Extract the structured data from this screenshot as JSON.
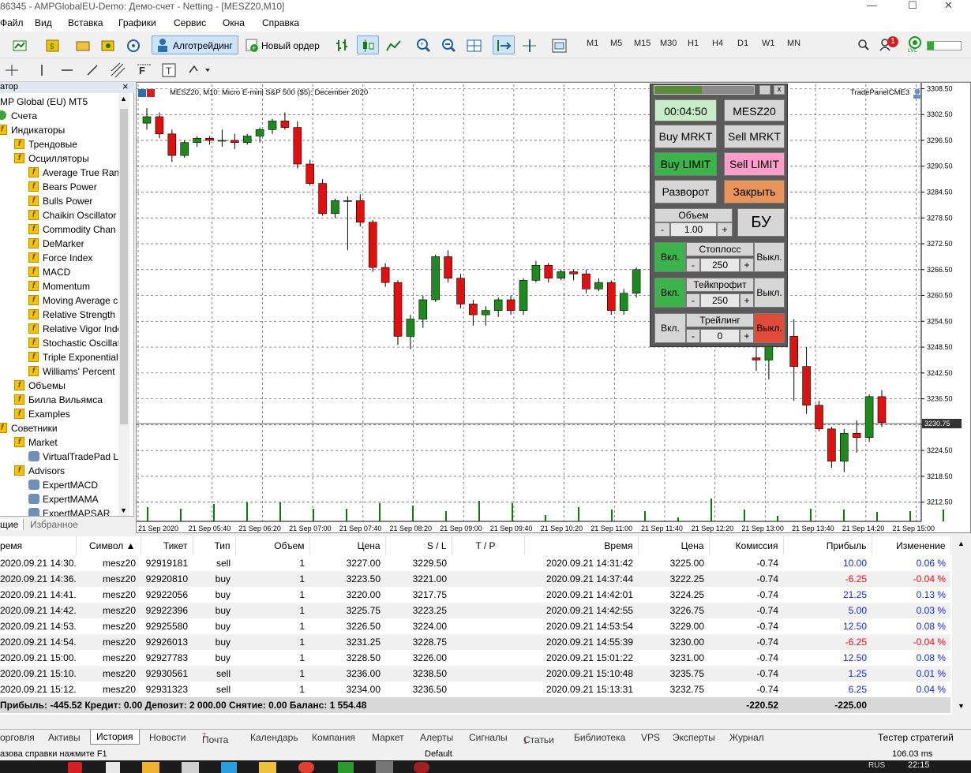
{
  "window": {
    "title": "86345 - AMPGlobalEU-Demo: Демо-счет - Netting - [MESZ20,M10]",
    "min_icon": "minimize-icon",
    "max_icon": "maximize-icon",
    "close_icon": "close-icon"
  },
  "menu": [
    "Файл",
    "Вид",
    "Вставка",
    "Графики",
    "Сервис",
    "Окна",
    "Справка"
  ],
  "toolbar": {
    "algo_label": "Алготрейдинг",
    "new_order_label": "Новый ордер",
    "timeframes": [
      "M1",
      "M5",
      "M15",
      "M30",
      "H1",
      "H4",
      "D1",
      "W1",
      "MN"
    ],
    "notification_count": "1",
    "signal_label": "LVL"
  },
  "navigator": {
    "header": "атор",
    "items": [
      {
        "label": "MP Global (EU) MT5",
        "type": "root"
      },
      {
        "label": "Счета",
        "type": "accounts"
      },
      {
        "label": "Индикаторы",
        "type": "folder"
      },
      {
        "label": "Трендовые",
        "type": "folder"
      },
      {
        "label": "Осцилляторы",
        "type": "folder"
      },
      {
        "label": "Average True Rang",
        "type": "ind"
      },
      {
        "label": "Bears Power",
        "type": "ind"
      },
      {
        "label": "Bulls Power",
        "type": "ind"
      },
      {
        "label": "Chaikin Oscillator",
        "type": "ind"
      },
      {
        "label": "Commodity Chan",
        "type": "ind"
      },
      {
        "label": "DeMarker",
        "type": "ind"
      },
      {
        "label": "Force Index",
        "type": "ind"
      },
      {
        "label": "MACD",
        "type": "ind"
      },
      {
        "label": "Momentum",
        "type": "ind"
      },
      {
        "label": "Moving Average c",
        "type": "ind"
      },
      {
        "label": "Relative Strength I",
        "type": "ind"
      },
      {
        "label": "Relative Vigor Inde",
        "type": "ind"
      },
      {
        "label": "Stochastic Oscillat",
        "type": "ind"
      },
      {
        "label": "Triple Exponential",
        "type": "ind"
      },
      {
        "label": "Williams' Percent",
        "type": "ind"
      },
      {
        "label": "Объемы",
        "type": "folder"
      },
      {
        "label": "Билла Вильямса",
        "type": "folder"
      },
      {
        "label": "Examples",
        "type": "folder"
      },
      {
        "label": "Советники",
        "type": "folder"
      },
      {
        "label": "Market",
        "type": "folder"
      },
      {
        "label": "VirtualTradePad  L",
        "type": "ea"
      },
      {
        "label": "Advisors",
        "type": "folder"
      },
      {
        "label": "ExpertMACD",
        "type": "ea"
      },
      {
        "label": "ExpertMAMA",
        "type": "ea"
      },
      {
        "label": "ExpertMAPSAR",
        "type": "ea"
      }
    ],
    "tab_common": "щие",
    "tab_favorites": "Избранное"
  },
  "chart": {
    "header": "MESZ20, M10:  Micro E-mini S&P 500 ($5): December 2020",
    "panel_name": "TradePanelCME3",
    "current_price": "3230.75"
  },
  "chart_data": {
    "type": "candlestick",
    "y_ticks": [
      "3308.50",
      "3302.50",
      "3296.50",
      "3290.50",
      "3284.50",
      "3278.50",
      "3272.50",
      "3266.50",
      "3260.50",
      "3254.50",
      "3248.50",
      "3242.50",
      "3236.50",
      "3230.50",
      "3224.50",
      "3218.50",
      "3212.50"
    ],
    "ylim": [
      3209.5,
      3309.5
    ],
    "x_ticks": [
      "21 Sep 2020",
      "21 Sep 05:40",
      "21 Sep 06:20",
      "21 Sep 07:00",
      "21 Sep 07:40",
      "21 Sep 08:20",
      "21 Sep 09:00",
      "21 Sep 09:40",
      "21 Sep 10:20",
      "21 Sep 11:00",
      "21 Sep 11:40",
      "21 Sep 12:20",
      "21 Sep 13:00",
      "21 Sep 13:40",
      "21 Sep 14:20",
      "21 Sep 15:00"
    ],
    "candles": [
      [
        3300.5,
        3304.0,
        3299.0,
        3302.0
      ],
      [
        3302.0,
        3303.0,
        3297.0,
        3298.0
      ],
      [
        3298.0,
        3299.0,
        3291.5,
        3293.0
      ],
      [
        3293.0,
        3296.5,
        3292.5,
        3296.0
      ],
      [
        3296.0,
        3297.5,
        3295.0,
        3297.0
      ],
      [
        3297.0,
        3297.5,
        3295.5,
        3296.5
      ],
      [
        3296.5,
        3299.0,
        3295.0,
        3296.5
      ],
      [
        3296.5,
        3298.0,
        3294.5,
        3296.0
      ],
      [
        3296.0,
        3298.0,
        3295.5,
        3297.5
      ],
      [
        3297.5,
        3299.5,
        3296.0,
        3299.0
      ],
      [
        3299.0,
        3301.5,
        3298.0,
        3301.0
      ],
      [
        3301.0,
        3303.0,
        3299.0,
        3299.5
      ],
      [
        3299.5,
        3301.0,
        3290.0,
        3291.0
      ],
      [
        3291.0,
        3292.0,
        3286.0,
        3286.5
      ],
      [
        3286.5,
        3287.5,
        3279.0,
        3279.5
      ],
      [
        3279.5,
        3283.0,
        3278.5,
        3282.5
      ],
      [
        3282.5,
        3283.5,
        3271.0,
        3282.5
      ],
      [
        3282.5,
        3284.0,
        3276.5,
        3277.5
      ],
      [
        3277.5,
        3278.0,
        3266.0,
        3267.0
      ],
      [
        3267.0,
        3268.0,
        3262.5,
        3263.5
      ],
      [
        3263.5,
        3264.0,
        3249.0,
        3251.0
      ],
      [
        3251.0,
        3256.0,
        3248.0,
        3255.0
      ],
      [
        3255.0,
        3260.5,
        3253.0,
        3259.5
      ],
      [
        3259.5,
        3270.0,
        3259.0,
        3269.5
      ],
      [
        3269.5,
        3271.0,
        3263.5,
        3264.5
      ],
      [
        3264.5,
        3265.5,
        3257.5,
        3258.5
      ],
      [
        3258.5,
        3259.5,
        3253.5,
        3256.0
      ],
      [
        3256.0,
        3258.0,
        3253.5,
        3257.0
      ],
      [
        3257.0,
        3260.0,
        3255.5,
        3259.5
      ],
      [
        3259.5,
        3260.5,
        3256.0,
        3257.0
      ],
      [
        3257.0,
        3264.5,
        3256.0,
        3264.0
      ],
      [
        3264.0,
        3268.5,
        3263.5,
        3267.5
      ],
      [
        3267.5,
        3268.0,
        3263.5,
        3264.5
      ],
      [
        3264.5,
        3266.5,
        3264.0,
        3266.0
      ],
      [
        3266.0,
        3266.5,
        3264.0,
        3265.5
      ],
      [
        3265.5,
        3266.5,
        3261.0,
        3262.0
      ],
      [
        3262.0,
        3264.5,
        3261.5,
        3263.5
      ],
      [
        3263.5,
        3264.0,
        3256.0,
        3257.0
      ],
      [
        3257.0,
        3262.0,
        3256.0,
        3261.0
      ],
      [
        3261.0,
        3267.0,
        3260.0,
        3266.5
      ],
      [
        3246.0,
        3251.0,
        3243.0,
        3245.5
      ],
      [
        3245.5,
        3253.5,
        3241.0,
        3252.5
      ],
      [
        3252.5,
        3254.0,
        3249.5,
        3251.0
      ],
      [
        3251.0,
        3255.0,
        3236.0,
        3244.0
      ],
      [
        3244.0,
        3248.5,
        3233.0,
        3235.0
      ],
      [
        3235.0,
        3236.0,
        3229.0,
        3229.5
      ],
      [
        3229.5,
        3230.0,
        3220.5,
        3222.0
      ],
      [
        3222.0,
        3229.5,
        3219.5,
        3228.5
      ],
      [
        3228.5,
        3231.5,
        3224.0,
        3227.5
      ],
      [
        3227.5,
        3237.5,
        3226.5,
        3237.0
      ],
      [
        3237.0,
        3238.5,
        3230.0,
        3231.0
      ]
    ],
    "volumes": [
      18,
      16,
      22,
      24,
      24,
      16,
      16,
      23,
      20,
      13,
      26,
      23,
      8,
      18,
      15,
      13,
      5,
      29,
      15,
      7,
      16,
      15,
      12,
      13,
      15
    ]
  },
  "panel": {
    "title": "TradePanelCME3",
    "timer": "00:04:50",
    "symbol": "MESZ20",
    "buy_market": "Buy MRKT",
    "sell_market": "Sell MRKT",
    "buy_limit": "Buy LIMIT",
    "sell_limit": "Sell LIMIT",
    "reverse": "Разворот",
    "close": "Закрыть",
    "volume_label": "Объем",
    "volume": "1.00",
    "minus": "-",
    "plus": "+",
    "breakeven": "БУ",
    "on": "Вкл.",
    "off": "Выкл.",
    "stoploss_label": "Стоплосс",
    "stoploss": "250",
    "takeprofit_label": "Тейкпрофит",
    "takeprofit": "250",
    "trailing_label": "Трейлинг",
    "trailing": "0",
    "colors": {
      "green": "#3cb44b",
      "pink": "#ff9ec8",
      "orange": "#e8945a",
      "red": "#e04b3a"
    }
  },
  "trades": {
    "columns": [
      "ремя",
      "Символ",
      "Тикет",
      "Тип",
      "Объем",
      "Цена",
      "S / L",
      "T / P",
      "Время",
      "Цена",
      "Комиссия",
      "Прибыль",
      "Изменение"
    ],
    "rows": [
      [
        "2020.09.21 14:30...",
        "mesz20",
        "92919181",
        "sell",
        "1",
        "3227.00",
        "3229.50",
        "",
        "2020.09.21 14:31:42",
        "3225.00",
        "-0.74",
        "10.00",
        "0.06 %"
      ],
      [
        "2020.09.21 14:36...",
        "mesz20",
        "92920810",
        "buy",
        "1",
        "3223.50",
        "3221.00",
        "",
        "2020.09.21 14:37:44",
        "3222.25",
        "-0.74",
        "-6.25",
        "-0.04 %"
      ],
      [
        "2020.09.21 14:41...",
        "mesz20",
        "92922056",
        "buy",
        "1",
        "3220.00",
        "3217.75",
        "",
        "2020.09.21 14:42:01",
        "3224.25",
        "-0.74",
        "21.25",
        "0.13 %"
      ],
      [
        "2020.09.21 14:42...",
        "mesz20",
        "92922396",
        "buy",
        "1",
        "3225.75",
        "3223.25",
        "",
        "2020.09.21 14:42:55",
        "3226.75",
        "-0.74",
        "5.00",
        "0.03 %"
      ],
      [
        "2020.09.21 14:53...",
        "mesz20",
        "92925580",
        "buy",
        "1",
        "3226.50",
        "3224.00",
        "",
        "2020.09.21 14:53:54",
        "3229.00",
        "-0.74",
        "12.50",
        "0.08 %"
      ],
      [
        "2020.09.21 14:54...",
        "mesz20",
        "92926013",
        "buy",
        "1",
        "3231.25",
        "3228.75",
        "",
        "2020.09.21 14:55:39",
        "3230.00",
        "-0.74",
        "-6.25",
        "-0.04 %"
      ],
      [
        "2020.09.21 15:00...",
        "mesz20",
        "92927783",
        "buy",
        "1",
        "3228.50",
        "3226.00",
        "",
        "2020.09.21 15:01:22",
        "3231.00",
        "-0.74",
        "12.50",
        "0.08 %"
      ],
      [
        "2020.09.21 15:10...",
        "mesz20",
        "92930561",
        "sell",
        "1",
        "3236.00",
        "3238.50",
        "",
        "2020.09.21 15:10:48",
        "3235.75",
        "-0.74",
        "1.25",
        "0.01 %"
      ],
      [
        "2020.09.21 15:12...",
        "mesz20",
        "92931323",
        "sell",
        "1",
        "3234.00",
        "3236.50",
        "",
        "2020.09.21 15:13:31",
        "3232.75",
        "-0.74",
        "6.25",
        "0.04 %"
      ]
    ],
    "summary": "Прибыль: -445.52  Кредит: 0.00  Депозит: 2 000.00  Снятие: 0.00  Баланс: 1 554.48",
    "total_commission": "-220.52",
    "total_profit": "-225.00"
  },
  "bottom_tabs": [
    "орговля",
    "Активы",
    "История",
    "Новости",
    "Почта",
    "Календарь",
    "Компания",
    "Маркет",
    "Алерты",
    "Сигналы",
    "Статьи",
    "Библиотека",
    "VPS",
    "Эксперты",
    "Журнал"
  ],
  "mail_count": "7",
  "articles_count": "1",
  "strategy_tester": "Тестер стратегий",
  "status": {
    "help": "азова справки нажмите F1",
    "profile": "Default",
    "ping": "106.03 ms"
  },
  "taskbar": {
    "time": "22:15",
    "lang": "RUS"
  }
}
